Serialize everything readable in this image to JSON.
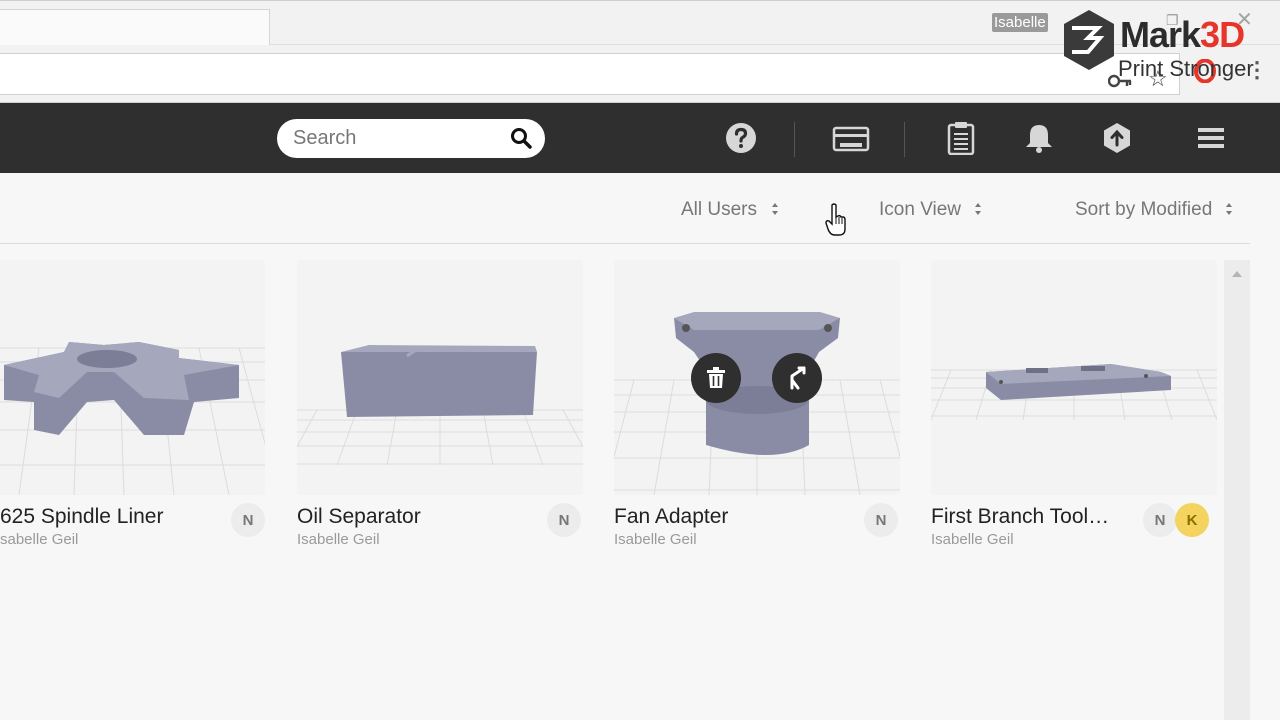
{
  "browser": {
    "profile_name": "Isabelle",
    "restore_glyph": "❐",
    "close_glyph": "✕",
    "star_glyph": "☆",
    "menu_glyph": "⋮",
    "icons": [
      "key-icon",
      "star-icon",
      "opera-icon",
      "kebab-menu-icon"
    ]
  },
  "watermark": {
    "brand_prefix": "Mark",
    "brand_accent": "3D",
    "tagline": "Print Stronger",
    "accent_color": "#e8352a"
  },
  "header": {
    "search_placeholder": "Search",
    "icons": [
      "help-icon",
      "printer-icon",
      "clipboard-icon",
      "bell-icon",
      "upload-icon",
      "hamburger-menu-icon"
    ],
    "background": "#2f2f2f"
  },
  "toolbar": {
    "user_filter": "All Users",
    "view_mode": "Icon View",
    "sort": "Sort by Modified"
  },
  "parts": [
    {
      "title": "625 Spindle Liner",
      "owner": "sabelle Geil",
      "badges": [
        "N"
      ]
    },
    {
      "title": "Oil Separator",
      "owner": "Isabelle Geil",
      "badges": [
        "N"
      ]
    },
    {
      "title": "Fan Adapter",
      "owner": "Isabelle Geil",
      "badges": [
        "N"
      ],
      "hover_actions": [
        "trash-icon",
        "branch-icon"
      ]
    },
    {
      "title": "First Branch Tool…",
      "owner": "Isabelle Geil",
      "badges": [
        "N",
        "K"
      ]
    }
  ],
  "colors": {
    "model": "#8a8ca6",
    "badge_k": "#f4d35e"
  }
}
